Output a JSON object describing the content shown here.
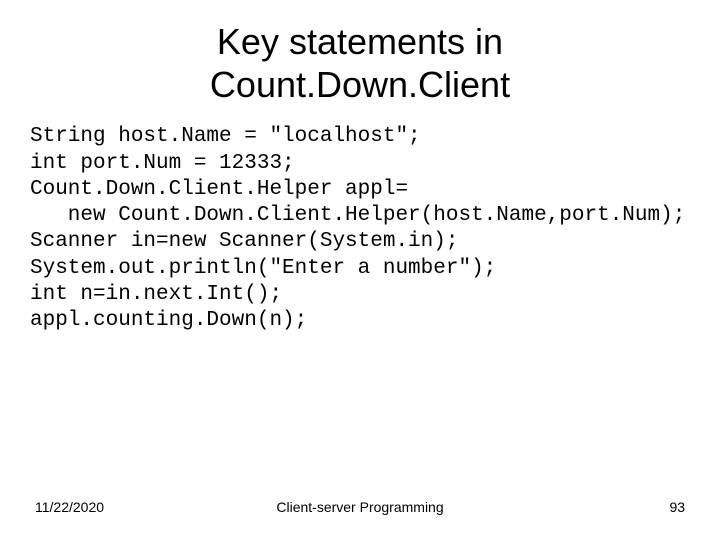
{
  "title_line1": "Key statements in",
  "title_line2": "Count.Down.Client",
  "code": "String host.Name = \"localhost\";\nint port.Num = 12333;\nCount.Down.Client.Helper appl=\n   new Count.Down.Client.Helper(host.Name,port.Num);\nScanner in=new Scanner(System.in);\nSystem.out.println(\"Enter a number\");\nint n=in.next.Int();\nappl.counting.Down(n);",
  "footer": {
    "date": "11/22/2020",
    "subject": "Client-server Programming",
    "page": "93"
  }
}
